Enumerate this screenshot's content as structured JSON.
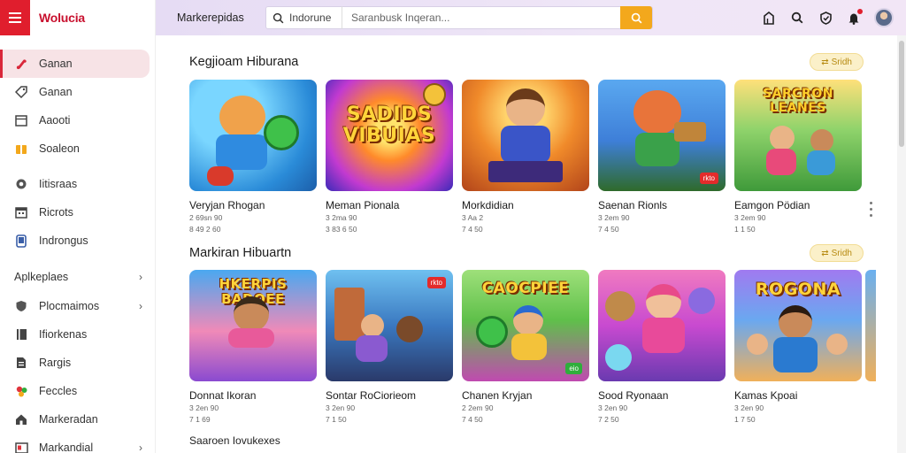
{
  "app": {
    "brand": "Wolucia",
    "market_label": "Markerepidas"
  },
  "search": {
    "scope": "Indorune",
    "placeholder": "Saranbusk Inqeran..."
  },
  "sidebar": {
    "items": [
      {
        "label": "Ganan",
        "icon": "gamepad-icon"
      },
      {
        "label": "Ganan",
        "icon": "tag-icon"
      },
      {
        "label": "Aaooti",
        "icon": "window-icon"
      },
      {
        "label": "Soaleon",
        "icon": "gift-icon"
      }
    ],
    "items2": [
      {
        "label": "Iitisraas",
        "icon": "camera-icon"
      },
      {
        "label": "Ricrots",
        "icon": "calendar-icon"
      },
      {
        "label": "Indrongus",
        "icon": "phone-icon"
      }
    ],
    "section": "Aplkeplaes",
    "items3": [
      {
        "label": "Plocmaimos",
        "icon": "shield-icon"
      },
      {
        "label": "Ifiorkenas",
        "icon": "book-icon"
      },
      {
        "label": "Rargis",
        "icon": "document-icon"
      },
      {
        "label": "Feccles",
        "icon": "flower-icon"
      },
      {
        "label": "Markeradan",
        "icon": "house-icon"
      },
      {
        "label": "Markandial",
        "icon": "card-icon"
      }
    ]
  },
  "sections": [
    {
      "title": "Kegjioam Hiburana",
      "button": "Sridh",
      "cards": [
        {
          "title": "Veryjan Rhogan",
          "meta1": "2 69sn 90",
          "meta2": "8 49 2 60",
          "art": "Orange",
          "logo": ""
        },
        {
          "title": "Meman Pionala",
          "meta1": "3 2ma 90",
          "meta2": "3 83 6 50",
          "art": "Sadids",
          "logo": "SADIDS VIBUIAS"
        },
        {
          "title": "Morkdidian",
          "meta1": "3 Aa 2",
          "meta2": "7 4 50",
          "art": "Hero",
          "logo": ""
        },
        {
          "title": "Saenan Rionls",
          "meta1": "3 2em 90",
          "meta2": "7 4 50",
          "art": "Fox",
          "badge": "rkto",
          "logo": ""
        },
        {
          "title": "Eamgon Pödian",
          "meta1": "3 2em 90",
          "meta2": "1 1 50",
          "art": "Jungle",
          "logo": "SARCRON LEANES"
        }
      ]
    },
    {
      "title": "Markiran Hibuartn",
      "button": "Sridh",
      "cards": [
        {
          "title": "Donnat Ikoran",
          "meta1": "3 2en 90",
          "meta2": "7 1 69",
          "art": "Rainbow",
          "logo": "HKERPIS BADOEE"
        },
        {
          "title": "Sontar RoCiorieom",
          "meta1": "3 2en 90",
          "meta2": "7 1 50",
          "art": "Town",
          "badge": "rkto",
          "logo": ""
        },
        {
          "title": "Chanen Kryjan",
          "meta1": "2 2em 90",
          "meta2": "7 4 50",
          "art": "Garden",
          "badge": "eio",
          "logo": "CAOCPIEE"
        },
        {
          "title": "Sood Ryonaan",
          "meta1": "3 2en 90",
          "meta2": "7 2 50",
          "art": "Pink",
          "logo": ""
        },
        {
          "title": "Kamas Kpoai",
          "meta1": "3 2en 90",
          "meta2": "1 7 50",
          "art": "Purple",
          "logo": "ROGONA"
        }
      ]
    }
  ],
  "bottom_section_title": "Saaroen Iovukexes"
}
